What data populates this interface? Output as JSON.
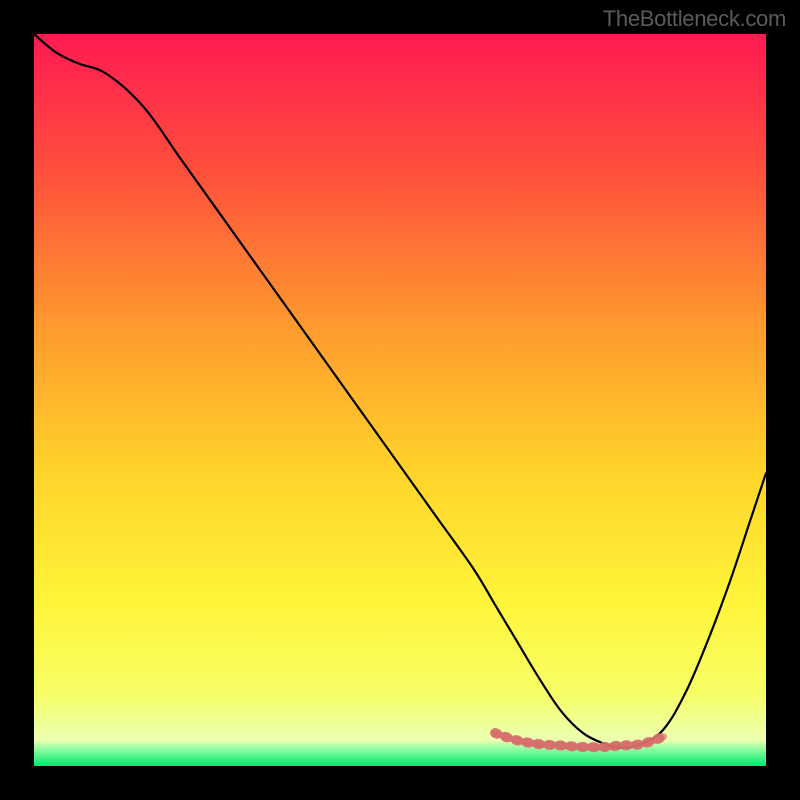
{
  "watermark": "TheBottleneck.com",
  "chart_data": {
    "type": "line",
    "title": "",
    "xlabel": "",
    "ylabel": "",
    "xlim": [
      0,
      100
    ],
    "ylim": [
      0,
      100
    ],
    "grid": false,
    "series": [
      {
        "name": "curve",
        "color": "#000000",
        "x": [
          0,
          3,
          6,
          10,
          15,
          20,
          25,
          30,
          35,
          40,
          45,
          50,
          55,
          60,
          63,
          66,
          69,
          72,
          75,
          78,
          80,
          83,
          86,
          89,
          92,
          95,
          98,
          100
        ],
        "y": [
          100,
          97.5,
          96,
          94.5,
          90,
          83,
          76,
          69,
          62,
          55,
          48,
          41,
          34,
          27,
          22,
          17,
          12,
          7.5,
          4.5,
          3,
          2.5,
          3,
          5,
          10,
          17,
          25,
          34,
          40
        ]
      },
      {
        "name": "highlight",
        "color": "#d76a6a",
        "x": [
          63,
          66,
          69,
          72,
          75,
          78,
          80,
          83,
          86
        ],
        "y": [
          4.5,
          3.5,
          3,
          2.8,
          2.6,
          2.6,
          2.8,
          3,
          4
        ]
      }
    ],
    "background": {
      "gradient_stops": [
        {
          "offset": 0.0,
          "color": "#ff1a52"
        },
        {
          "offset": 0.18,
          "color": "#ff4d3d"
        },
        {
          "offset": 0.4,
          "color": "#ff9a2e"
        },
        {
          "offset": 0.6,
          "color": "#ffd42a"
        },
        {
          "offset": 0.78,
          "color": "#fff53a"
        },
        {
          "offset": 0.9,
          "color": "#f7ff66"
        },
        {
          "offset": 0.965,
          "color": "#ecffb0"
        },
        {
          "offset": 0.975,
          "color": "#9cffa6"
        },
        {
          "offset": 1.0,
          "color": "#00e86b"
        }
      ]
    }
  }
}
